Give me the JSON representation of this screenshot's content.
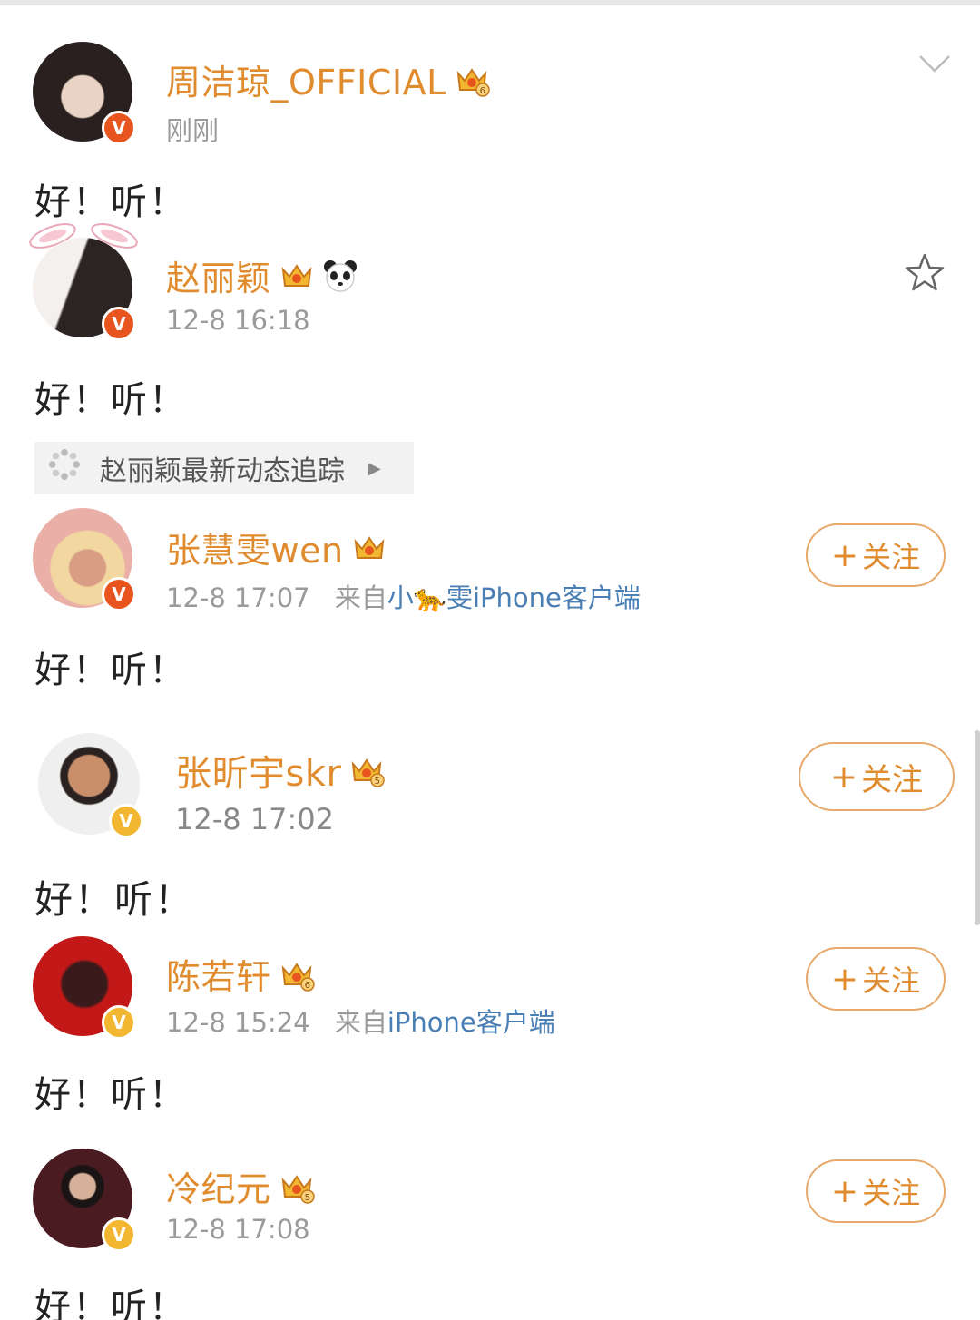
{
  "posts": [
    {
      "name": "周洁琼_OFFICIAL",
      "time": "刚刚",
      "from_label": "",
      "source": "",
      "content": "好！听！",
      "badge": "red",
      "crown_level": "6",
      "action": "chevron-down-icon"
    },
    {
      "name": "赵丽颖",
      "time": "12-8 16:18",
      "from_label": "",
      "source": "",
      "content": "好！听！",
      "badge": "red",
      "crown_level": "",
      "action": "star-icon"
    },
    {
      "name": "张慧雯wen",
      "time": "12-8 17:07",
      "from_label": "来自",
      "source": "小🐆雯iPhone客户端",
      "content": "好！听！",
      "badge": "red",
      "crown_level": "",
      "action": "follow"
    },
    {
      "name": "张昕宇skr",
      "time": "12-8 17:02",
      "from_label": "",
      "source": "",
      "content": "好！听！",
      "badge": "gold",
      "crown_level": "5",
      "action": "follow"
    },
    {
      "name": "陈若轩",
      "time": "12-8 15:24",
      "from_label": "来自",
      "source": "iPhone客户端",
      "content": "好！听！",
      "badge": "gold",
      "crown_level": "6",
      "action": "follow"
    },
    {
      "name": "冷纪元",
      "time": "12-8 17:08",
      "from_label": "",
      "source": "",
      "content": "好！听！",
      "badge": "gold",
      "crown_level": "5",
      "action": "follow"
    }
  ],
  "follow_label": "关注",
  "follow_plus": "+",
  "tracking": {
    "label": "赵丽颖最新动态追踪"
  },
  "verify_mark": "V",
  "colors": {
    "name_orange": "#e08c2e",
    "meta_gray": "#9a9a9a",
    "source_blue": "#4a7fb5",
    "badge_red": "#e8541e",
    "badge_gold": "#f2b630",
    "follow_border": "#e8a86a"
  }
}
